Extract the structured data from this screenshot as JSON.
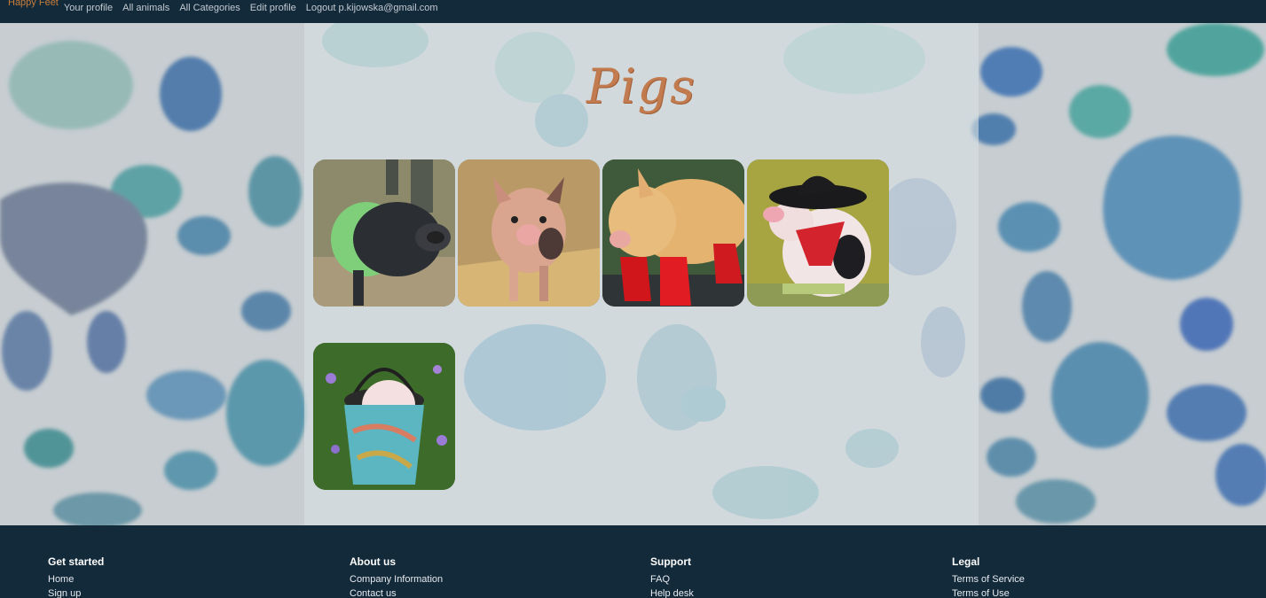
{
  "nav": {
    "brand": "Happy Feet",
    "links": [
      "Your profile",
      "All animals",
      "All Categories",
      "Edit profile",
      "Logout p.kijowska@gmail.com"
    ]
  },
  "category": {
    "title": "Pigs"
  },
  "gallery": {
    "items": [
      {
        "name": "black-pig-in-green-sweater",
        "tone": "#3c4a2e"
      },
      {
        "name": "spotted-piglet-in-straw",
        "tone": "#b58b58"
      },
      {
        "name": "piglet-in-red-boots",
        "tone": "#d6a25c"
      },
      {
        "name": "piglet-in-cowboy-hat",
        "tone": "#a39a46"
      },
      {
        "name": "piglet-in-bucket",
        "tone": "#3f6a2c"
      }
    ]
  },
  "footer": {
    "columns": [
      {
        "heading": "Get started",
        "links": [
          "Home",
          "Sign up"
        ]
      },
      {
        "heading": "About us",
        "links": [
          "Company Information",
          "Contact us"
        ]
      },
      {
        "heading": "Support",
        "links": [
          "FAQ",
          "Help desk"
        ]
      },
      {
        "heading": "Legal",
        "links": [
          "Terms of Service",
          "Terms of Use"
        ]
      }
    ]
  },
  "colors": {
    "nav_bg": "#132a3b",
    "brand": "#c77d39",
    "title": "#c27a4f",
    "panel": "#d6e0e4"
  }
}
